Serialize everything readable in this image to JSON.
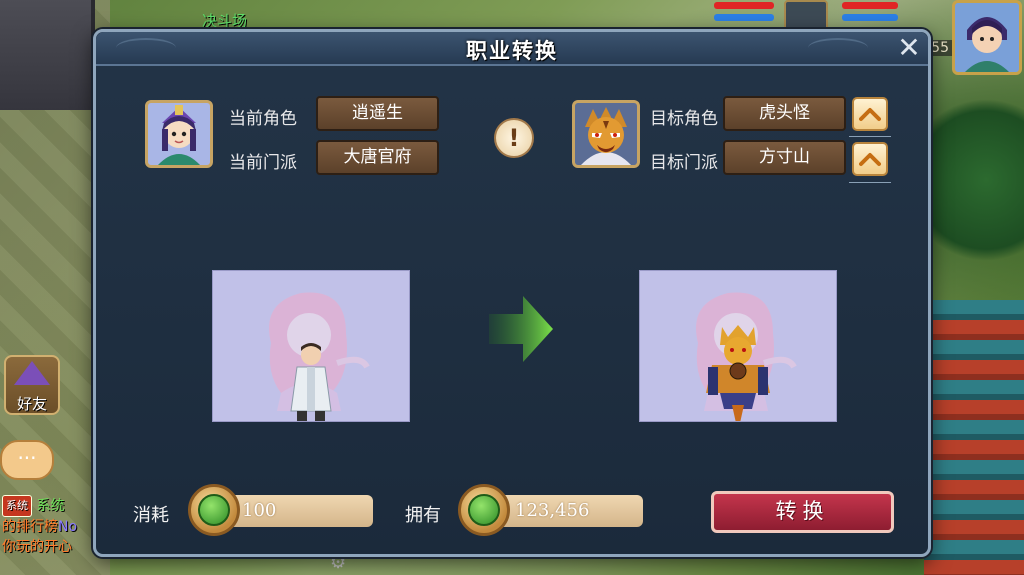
{
  "hud": {
    "arena_label": "决斗场",
    "level": "55",
    "friends_label": "好友",
    "chat_icon": "···",
    "chat_line1_tag": "系统",
    "chat_line1_text": "系统",
    "chat_line2_text": "的排行榜",
    "chat_line2_suffix": "No",
    "chat_line3_text": "你玩的开心"
  },
  "dialog": {
    "title": "职业转换",
    "close_icon": "✕",
    "current": {
      "role_label": "当前角色",
      "role_value": "逍遥生",
      "sect_label": "当前门派",
      "sect_value": "大唐官府"
    },
    "target": {
      "role_label": "目标角色",
      "role_value": "虎头怪",
      "sect_label": "目标门派",
      "sect_value": "方寸山"
    },
    "info_icon": "!",
    "cost": {
      "label": "消耗",
      "value": "100"
    },
    "owned": {
      "label": "拥有",
      "value": "123,456"
    },
    "convert_button": "转换"
  },
  "colors": {
    "dialog_bg": "#1b2a3b",
    "value_box": "#6b4b33",
    "convert_button": "#a8283e",
    "arrow_green": "#5fd03a"
  },
  "icons": [
    "close-icon",
    "exclamation-icon",
    "chevron-up-icon",
    "green-arrow-right-icon",
    "jade-coin-icon",
    "gear-icon"
  ]
}
